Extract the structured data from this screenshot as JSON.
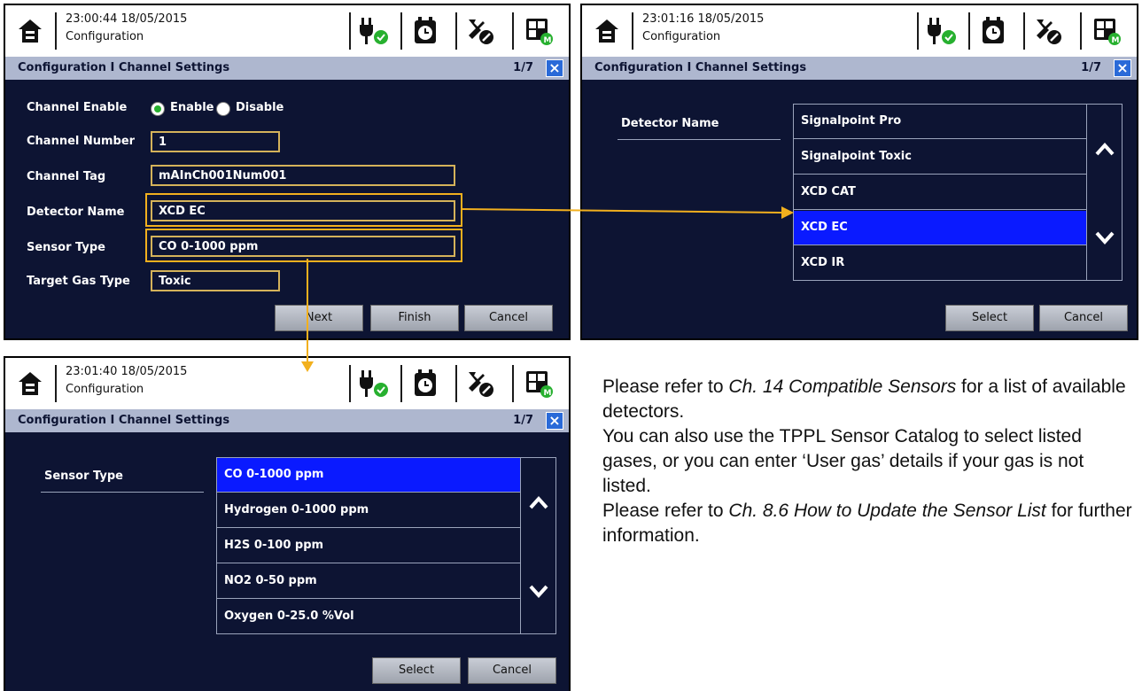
{
  "screen1": {
    "time": "23:00:44 18/05/2015",
    "context": "Configuration",
    "title": "Configuration I Channel Settings",
    "page": "1/7",
    "close": "×",
    "fields": {
      "enable_label": "Channel Enable",
      "enable_opt": "Enable",
      "disable_opt": "Disable",
      "number_label": "Channel Number",
      "number_value": "1",
      "tag_label": "Channel Tag",
      "tag_value": "mAInCh001Num001",
      "detector_label": "Detector Name",
      "detector_value": "XCD EC",
      "sensor_label": "Sensor Type",
      "sensor_value": "CO 0-1000 ppm",
      "target_label": "Target Gas Type",
      "target_value": "Toxic"
    },
    "buttons": {
      "next": "Next",
      "finish": "Finish",
      "cancel": "Cancel"
    }
  },
  "screen2": {
    "time": "23:01:16 18/05/2015",
    "context": "Configuration",
    "title": "Configuration I Channel Settings",
    "page": "1/7",
    "close": "×",
    "label": "Detector Name",
    "items": [
      "Signalpoint Pro",
      "Signalpoint Toxic",
      "XCD CAT",
      "XCD EC",
      "XCD IR"
    ],
    "selected_index": 3,
    "buttons": {
      "select": "Select",
      "cancel": "Cancel"
    }
  },
  "screen3": {
    "time": "23:01:40 18/05/2015",
    "context": "Configuration",
    "title": "Configuration I Channel Settings",
    "page": "1/7",
    "close": "×",
    "label": "Sensor Type",
    "items": [
      "CO 0-1000 ppm",
      "Hydrogen 0-1000 ppm",
      "H2S 0-100 ppm",
      "NO2 0-50 ppm",
      "Oxygen 0-25.0 %Vol"
    ],
    "selected_index": 0,
    "buttons": {
      "select": "Select",
      "cancel": "Cancel"
    }
  },
  "note": {
    "l1_a": "Please refer to ",
    "l1_b": "Ch. 14 Compatible Sensors",
    "l1_c": " for a list of available detectors.",
    "l2": "You can also use the TPPL Sensor Catalog to select listed gases, or you can enter ‘User gas’ details if your gas is not listed.",
    "l3_a": "Please refer to ",
    "l3_b": "Ch. 8.6 How to Update the Sensor List",
    "l3_c": " for further information."
  },
  "colors": {
    "screen_bg": "#0d1433",
    "titlebar": "#aeb7cf",
    "selected_row": "#0a1aff",
    "field_border": "#d4b25a",
    "highlight": "#f2b01e",
    "status_ok": "#27b02f"
  },
  "icons": [
    "home-icon",
    "power-ok-icon",
    "timer-icon",
    "tools-icon",
    "module-icon",
    "chevron-up-icon",
    "chevron-down-icon",
    "close-icon"
  ]
}
